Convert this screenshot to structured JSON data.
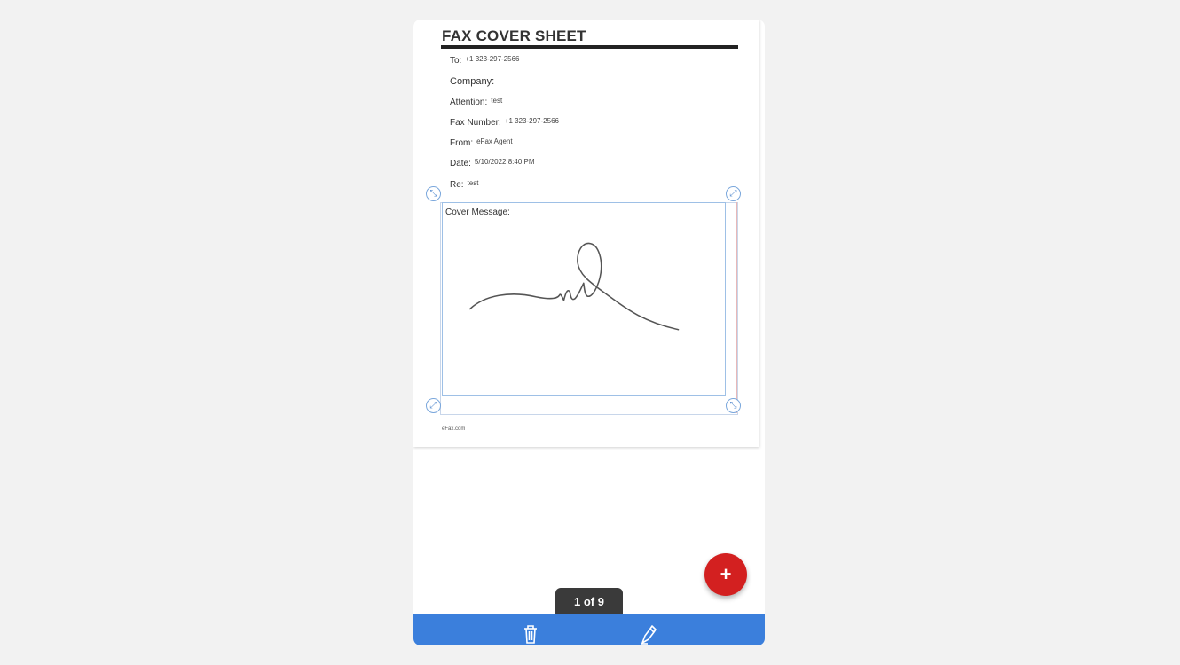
{
  "document": {
    "title": "FAX COVER SHEET",
    "fields": [
      {
        "label": "To:",
        "value": "+1 323-297-2566"
      },
      {
        "label": "Company:",
        "value": ""
      },
      {
        "label": "Attention:",
        "value": "test"
      },
      {
        "label": "Fax Number:",
        "value": "+1 323-297-2566"
      },
      {
        "label": "From:",
        "value": "eFax Agent"
      },
      {
        "label": "Date:",
        "value": "5/10/2022 8:40 PM"
      },
      {
        "label": "Re:",
        "value": "test"
      }
    ],
    "cover_message_label": "Cover Message:",
    "footer": "eFax.com"
  },
  "controls": {
    "add_button": "+",
    "page_indicator": "1 of 9"
  },
  "toolbar": {
    "icons": [
      "trash-icon",
      "pen-icon"
    ],
    "accent": "#3b7fdc"
  },
  "colors": {
    "fab": "#d32020",
    "selection": "#9ec0e6"
  }
}
